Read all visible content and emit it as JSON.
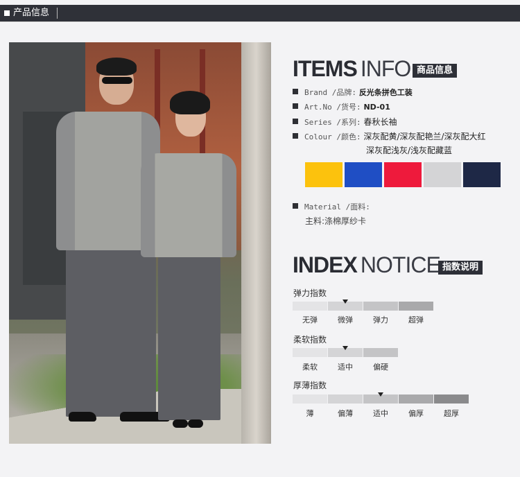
{
  "header": {
    "title": "产品信息"
  },
  "items_info": {
    "heading_bold": "ITEMS",
    "heading_light": "INFO",
    "badge": "商品信息",
    "brand": {
      "label": "Brand /品牌:",
      "value": "反光条拼色工装"
    },
    "art_no": {
      "label": "Art.No /货号:",
      "value": "ND-01"
    },
    "series": {
      "label": "Series /系列:",
      "value": "春秋长袖"
    },
    "colour": {
      "label": "Colour /颜色:",
      "line1": "深灰配黄/深灰配艳兰/深灰配大红",
      "line2": "深灰配浅灰/浅灰配藏蓝"
    },
    "swatches": [
      "#fcc20d",
      "#1f4ec4",
      "#ee1a3c",
      "#d4d4d6",
      "#1e2846"
    ],
    "material": {
      "label": "Material /面料:",
      "value": "主料:涤棉厚纱卡"
    }
  },
  "index_notice": {
    "heading_bold": "INDEX",
    "heading_light": "NOTICE",
    "badge": "指数说明",
    "elasticity": {
      "title": "弹力指数",
      "levels": [
        "无弹",
        "微弹",
        "弹力",
        "超弹"
      ],
      "selected": 1
    },
    "softness": {
      "title": "柔软指数",
      "levels": [
        "柔软",
        "适中",
        "偏硬"
      ],
      "selected": 1
    },
    "thickness": {
      "title": "厚薄指数",
      "levels": [
        "薄",
        "偏薄",
        "适中",
        "偏厚",
        "超厚"
      ],
      "selected": 2
    }
  }
}
